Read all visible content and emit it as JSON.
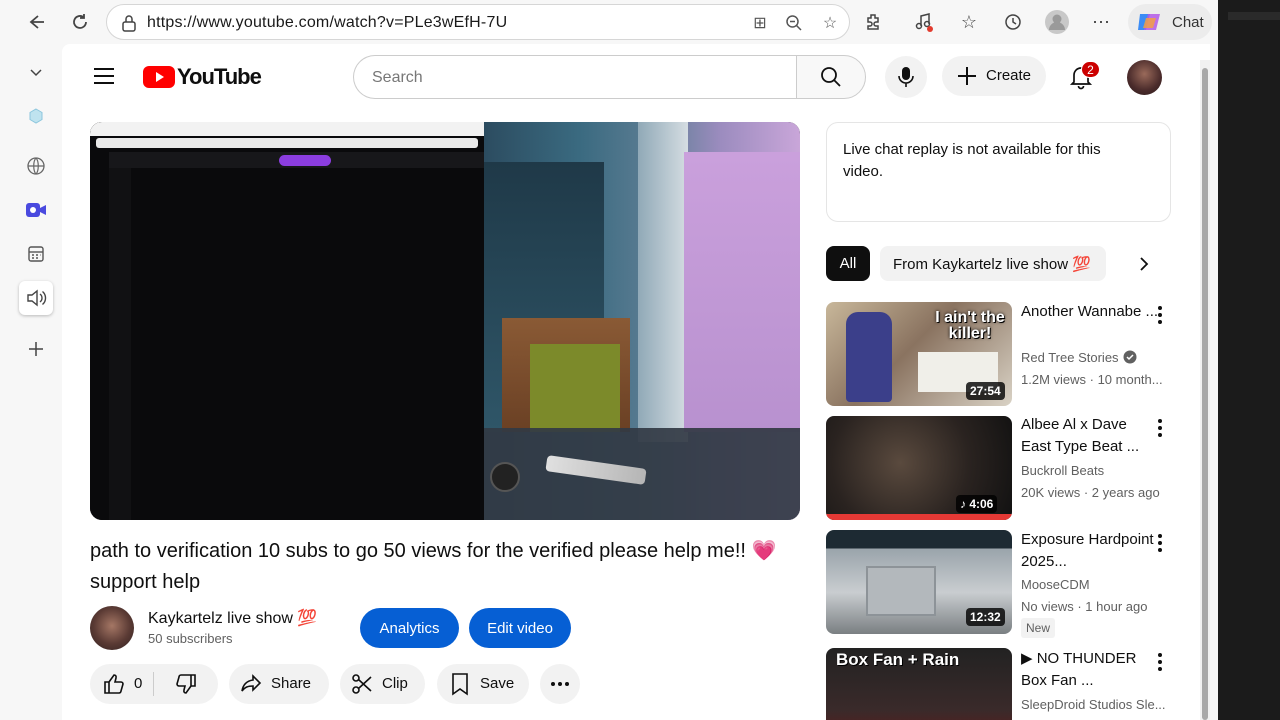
{
  "browser": {
    "url": "https://www.youtube.com/watch?v=PLe3wEfH-7U",
    "chat_label": "Chat"
  },
  "youtube": {
    "logo_text": "YouTube",
    "search_placeholder": "Search",
    "create_label": "Create",
    "notification_count": "2"
  },
  "video": {
    "title": "path to verification 10 subs to go 50 views for the verified please help me!! 💗 support help",
    "channel_name": "Kaykartelz live show 💯",
    "subscribers": "50 subscribers",
    "analytics_label": "Analytics",
    "edit_label": "Edit video",
    "like_count": "0",
    "share_label": "Share",
    "clip_label": "Clip",
    "save_label": "Save"
  },
  "sidebar_right": {
    "chat_replay_text": "Live chat replay is not available for this video.",
    "chips": [
      "All",
      "From Kaykartelz live show 💯"
    ],
    "recommendations": [
      {
        "title": "Another Wannabe ...",
        "channel": "Red Tree Stories",
        "verified": true,
        "meta": "1.2M views · 10 month...",
        "duration": "27:54",
        "thumb_text": "I ain't the killer!"
      },
      {
        "title": "Albee Al x Dave East Type Beat ...",
        "channel": "Buckroll Beats",
        "verified": false,
        "meta": "20K views · 2 years ago",
        "duration": "♪ 4:06"
      },
      {
        "title": "Exposure Hardpoint 2025...",
        "channel": "MooseCDM",
        "verified": false,
        "meta": "No views · 1 hour ago",
        "duration": "12:32",
        "badge": "New"
      },
      {
        "title": "▶ NO THUNDER Box Fan ...",
        "channel": "SleepDroid Studios Sle...",
        "verified": false,
        "meta": "",
        "duration": "",
        "thumb_text": "Box Fan + Rain"
      }
    ]
  }
}
